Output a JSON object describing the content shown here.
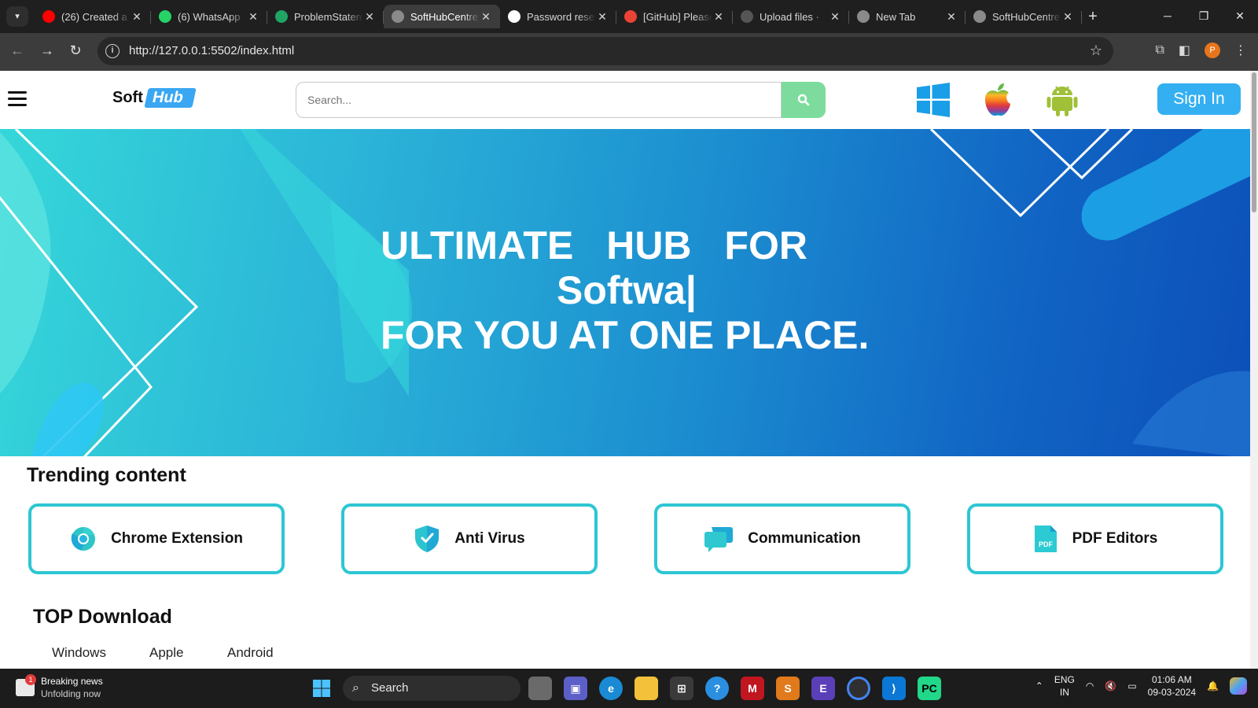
{
  "browser": {
    "tabs": [
      {
        "title": "(26) Created a",
        "favicon": "youtube-icon",
        "color": "#ff0000"
      },
      {
        "title": "(6) WhatsApp",
        "favicon": "whatsapp-icon",
        "color": "#25d366"
      },
      {
        "title": "ProblemStatem",
        "favicon": "sheets-icon",
        "color": "#1fa463"
      },
      {
        "title": "SoftHubCentre",
        "favicon": "globe-icon",
        "color": "#8a8a8a",
        "active": true
      },
      {
        "title": "Password reset",
        "favicon": "github-icon",
        "color": "#ffffff"
      },
      {
        "title": "[GitHub] Please",
        "favicon": "gmail-icon",
        "color": "#ea4335"
      },
      {
        "title": "Upload files ·",
        "favicon": "loading-icon",
        "color": "#555555"
      },
      {
        "title": "New Tab",
        "favicon": "chrome-icon",
        "color": "#8a8a8a"
      },
      {
        "title": "SoftHubCentre",
        "favicon": "globe-icon",
        "color": "#8a8a8a"
      }
    ],
    "url": "http://127.0.0.1:5502/index.html",
    "profile_initial": "P"
  },
  "site": {
    "logo_part1": "Soft",
    "logo_part2": "Hub",
    "search_placeholder": "Search...",
    "sign_in": "Sign In",
    "platforms": [
      "windows-icon",
      "apple-icon",
      "android-icon"
    ]
  },
  "hero": {
    "line1": "ULTIMATE HUB FOR",
    "line2": "Softwa|",
    "line3": "FOR YOU AT ONE PLACE."
  },
  "trending": {
    "title": "Trending content",
    "items": [
      {
        "label": "Chrome Extension",
        "icon": "chrome-extension-icon"
      },
      {
        "label": "Anti Virus",
        "icon": "shield-icon"
      },
      {
        "label": "Communication",
        "icon": "chat-icon"
      },
      {
        "label": "PDF Editors",
        "icon": "pdf-icon",
        "icon_text": "PDF"
      }
    ]
  },
  "top_download": {
    "title": "TOP Download",
    "categories": [
      "Windows",
      "Apple",
      "Android"
    ]
  },
  "taskbar": {
    "news_title": "Breaking news",
    "news_sub": "Unfolding now",
    "news_badge": "1",
    "search_label": "Search",
    "lang1": "ENG",
    "lang2": "IN",
    "time": "01:06 AM",
    "date": "09-03-2024"
  },
  "colors": {
    "accent": "#34b0f2",
    "search_button": "#7ddc9d",
    "card_border": "#2dc6d3",
    "hero_start": "#35d7d9",
    "hero_end": "#0c4fb8"
  }
}
